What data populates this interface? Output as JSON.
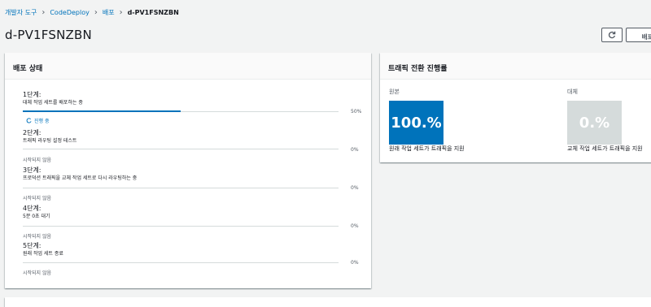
{
  "breadcrumb": {
    "items": [
      "개발자 도구",
      "CodeDeploy",
      "배포"
    ],
    "current": "d-PV1FSNZBN"
  },
  "page": {
    "title": "d-PV1FSNZBN",
    "action_label": "배포 중지"
  },
  "status_card": {
    "header": "배포 상태",
    "steps": [
      {
        "title": "1단계:",
        "desc": "대체 작업 세트를 배포하는 중",
        "percent": "50%",
        "progress": 0.5,
        "status": "진행 중",
        "status_icon": "spinner-icon"
      },
      {
        "title": "2단계:",
        "desc": "트래픽 라우팅 설정 테스트",
        "percent": "0%",
        "progress": 0,
        "status": "시작되지 않음"
      },
      {
        "title": "3단계:",
        "desc": "프로덕션 트래픽을 교체 작업 세트로 다시 라우팅하는 중",
        "percent": "0%",
        "progress": 0,
        "status": "시작되지 않음"
      },
      {
        "title": "4단계:",
        "desc": "5분 0초 대기",
        "percent": "0%",
        "progress": 0,
        "status": "시작되지 않음"
      },
      {
        "title": "5단계:",
        "desc": "원래 작업 세트 종료",
        "percent": "0%",
        "progress": 0,
        "status": "시작되지 않음"
      }
    ]
  },
  "traffic_card": {
    "header": "트래픽 전환 진행률",
    "original": {
      "label": "원본",
      "value": "100.%",
      "caption": "원래 작업 세트가 트래픽을 지원",
      "color": "#0073bb"
    },
    "replacement": {
      "label": "대체",
      "value": "0.%",
      "caption": "교체 작업 세트가 트래픽을 지원",
      "color": "#d5dbdb"
    }
  }
}
